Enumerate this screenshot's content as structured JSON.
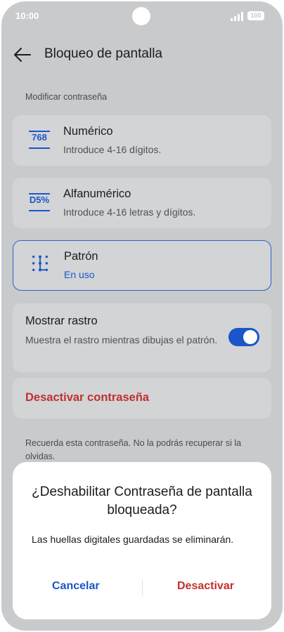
{
  "status": {
    "time": "10:00",
    "battery": "100"
  },
  "header": {
    "title": "Bloqueo de pantalla"
  },
  "section": {
    "label": "Modificar contraseña"
  },
  "options": [
    {
      "title": "Numérico",
      "subtitle": "Introduce 4-16 dígitos.",
      "icon_text": "768",
      "icon": "numeric-pin-icon"
    },
    {
      "title": "Alfanumérico",
      "subtitle": "Introduce 4-16 letras y dígitos.",
      "icon_text": "D5%",
      "icon": "alphanumeric-icon"
    },
    {
      "title": "Patrón",
      "subtitle": "En uso",
      "icon": "pattern-icon",
      "selected": true
    }
  ],
  "trace": {
    "title": "Mostrar rastro",
    "subtitle": "Muestra el rastro mientras dibujas el patrón.",
    "enabled": true
  },
  "deactivate": {
    "label": "Desactivar contraseña"
  },
  "note": "Recuerda esta contraseña. No la podrás recuperar si la olvidas.",
  "dialog": {
    "title": "¿Deshabilitar Contraseña de pantalla bloqueada?",
    "body": "Las huellas digitales guardadas se eliminarán.",
    "cancel_label": "Cancelar",
    "confirm_label": "Desactivar"
  },
  "colors": {
    "accent": "#1a56c9",
    "danger": "#c0302f",
    "scrim": "#c9cacc"
  }
}
